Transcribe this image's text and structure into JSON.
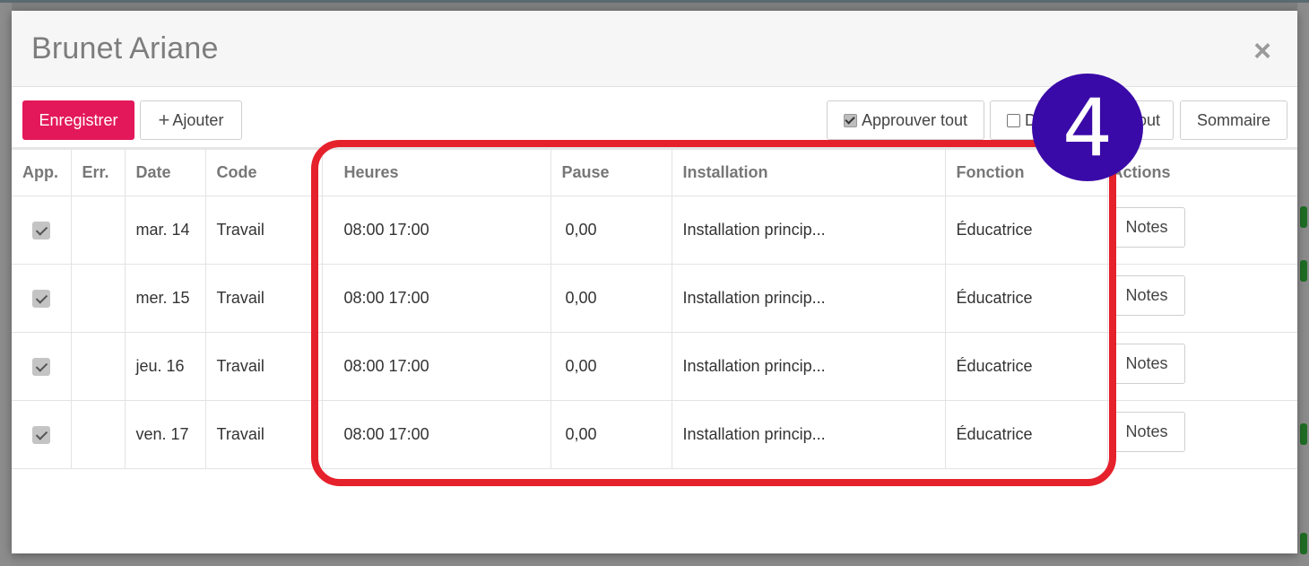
{
  "modal": {
    "title": "Brunet Ariane",
    "close_icon": "close-icon"
  },
  "toolbar": {
    "save_label": "Enregistrer",
    "add_label": "Ajouter",
    "approve_all_label": "Approuver tout",
    "disapprove_all_label_visible_start": "D",
    "disapprove_all_label_visible_end": "out",
    "summary_label": "Sommaire"
  },
  "table": {
    "headers": [
      "App.",
      "Err.",
      "Date",
      "Code",
      "Heures",
      "Pause",
      "Installation",
      "Fonction",
      "Actions"
    ],
    "rows": [
      {
        "approved": true,
        "error": "",
        "date": "mar. 14",
        "code": "Travail",
        "hours": "08:00 17:00",
        "pause": "0,00",
        "installation": "Installation princip...",
        "function": "Éducatrice",
        "action_label": "Notes"
      },
      {
        "approved": true,
        "error": "",
        "date": "mer. 15",
        "code": "Travail",
        "hours": "08:00 17:00",
        "pause": "0,00",
        "installation": "Installation princip...",
        "function": "Éducatrice",
        "action_label": "Notes"
      },
      {
        "approved": true,
        "error": "",
        "date": "jeu. 16",
        "code": "Travail",
        "hours": "08:00 17:00",
        "pause": "0,00",
        "installation": "Installation princip...",
        "function": "Éducatrice",
        "action_label": "Notes"
      },
      {
        "approved": true,
        "error": "",
        "date": "ven. 17",
        "code": "Travail",
        "hours": "08:00 17:00",
        "pause": "0,00",
        "installation": "Installation princip...",
        "function": "Éducatrice",
        "action_label": "Notes"
      }
    ]
  },
  "annotation": {
    "step_number": "4",
    "highlight_color": "#e5212b",
    "badge_color": "#3a0aa8"
  },
  "colors": {
    "primary_button": "#e3185b",
    "overlay": "#7f7f7f"
  }
}
